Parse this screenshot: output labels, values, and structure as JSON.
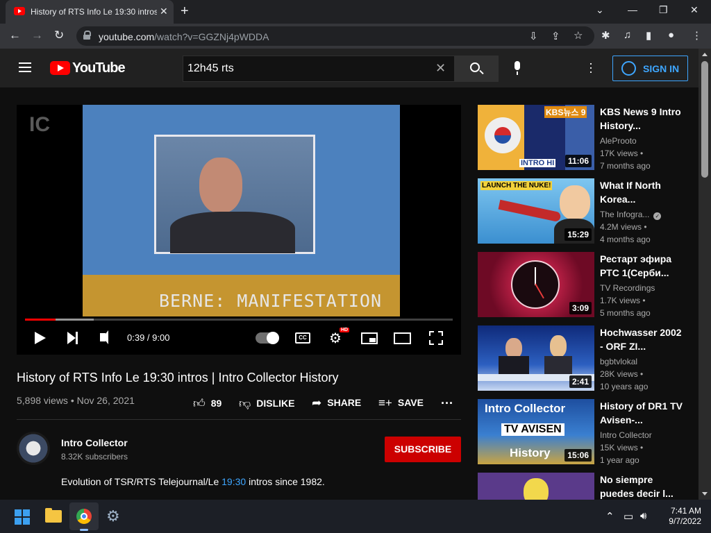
{
  "browser": {
    "tab_title": "History of RTS Info Le 19:30 intros | Intro Collector History",
    "url_host": "youtube.com",
    "url_path": "/watch?v=GGZNj4pWDDA"
  },
  "masthead": {
    "logo_text": "YouTube",
    "search_value": "12h45 rts",
    "sign_in_label": "SIGN IN"
  },
  "player": {
    "watermark": "IC",
    "caption": "BERNE: MANIFESTATION",
    "time": "0:39 / 9:00",
    "played_fraction": 0.072,
    "buffered_fraction": 0.16,
    "hd_badge": "HD",
    "cc_label": "CC"
  },
  "video": {
    "title": "History of RTS Info Le 19:30 intros | Intro Collector History",
    "meta": "5,898 views • Nov 26, 2021",
    "likes": "89",
    "dislike_label": "DISLIKE",
    "share_label": "SHARE",
    "save_label": "SAVE"
  },
  "channel": {
    "name": "Intro Collector",
    "subscribers": "8.32K subscribers",
    "subscribe_label": "SUBSCRIBE",
    "description_before": "Evolution of TSR/RTS Telejournal/Le ",
    "description_timestamp": "19:30",
    "description_after": " intros since 1982."
  },
  "recommendations": [
    {
      "title": "KBS News 9 Intro History...",
      "channel": "AleProoto",
      "views": "17K views •",
      "age": "7 months ago",
      "duration": "11:06",
      "verified": false
    },
    {
      "title": "What If North Korea...",
      "channel": "The Infogra...",
      "views": "4.2M views •",
      "age": "4 months ago",
      "duration": "15:29",
      "verified": true
    },
    {
      "title": "Рестарт эфира РТС 1(Серби...",
      "channel": "TV Recordings",
      "views": "1.7K views •",
      "age": "5 months ago",
      "duration": "3:09",
      "verified": false
    },
    {
      "title": "Hochwasser 2002 - ORF ZI...",
      "channel": "bgbtvlokal",
      "views": "28K views •",
      "age": "10 years ago",
      "duration": "2:41",
      "verified": false
    },
    {
      "title": "History of DR1 TV Avisen-...",
      "channel": "Intro Collector",
      "views": "15K views •",
      "age": "1 year ago",
      "duration": "15:06",
      "verified": false
    },
    {
      "title": "No siempre puedes decir l...",
      "channel": "",
      "views": "",
      "age": "",
      "duration": "",
      "verified": false
    }
  ],
  "thumb_text": {
    "kbs": "KBS뉴스 9",
    "kbs_bottom": "INTRO HI",
    "nuke": "LAUNCH THE NUKE!",
    "dr1_top": "Intro Collector",
    "dr1_mid": "TV AVISEN",
    "dr1_bottom": "History"
  },
  "taskbar": {
    "time": "7:41 AM",
    "date": "9/7/2022"
  }
}
